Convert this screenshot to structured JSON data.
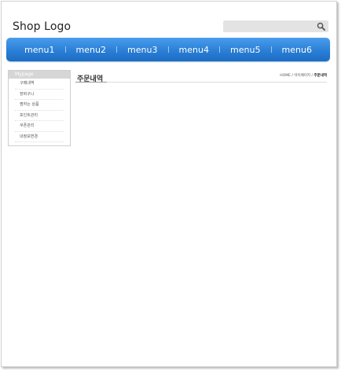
{
  "header": {
    "logo_text": "Shop Logo",
    "search_icon": "search-icon"
  },
  "nav": {
    "items": [
      {
        "label": "menu1"
      },
      {
        "label": "menu2"
      },
      {
        "label": "menu3"
      },
      {
        "label": "menu4"
      },
      {
        "label": "menu5"
      },
      {
        "label": "menu6"
      }
    ]
  },
  "sidebar": {
    "title": "Mypage",
    "items": [
      {
        "label": "구매내역"
      },
      {
        "label": "장바구니"
      },
      {
        "label": "찜하는 상품"
      },
      {
        "label": "포인트관리"
      },
      {
        "label": "쿠폰관리"
      },
      {
        "label": "내정보변경"
      }
    ]
  },
  "main": {
    "page_title": "주문내역",
    "breadcrumb": {
      "home": "HOME",
      "sep1": " / ",
      "mid": "마이페이지",
      "sep2": " / ",
      "current": "주문내역"
    }
  },
  "colors": {
    "nav_gradient_top": "#4a9ded",
    "nav_gradient_bottom": "#1d6cc3",
    "search_bg": "#e3e3e3"
  }
}
